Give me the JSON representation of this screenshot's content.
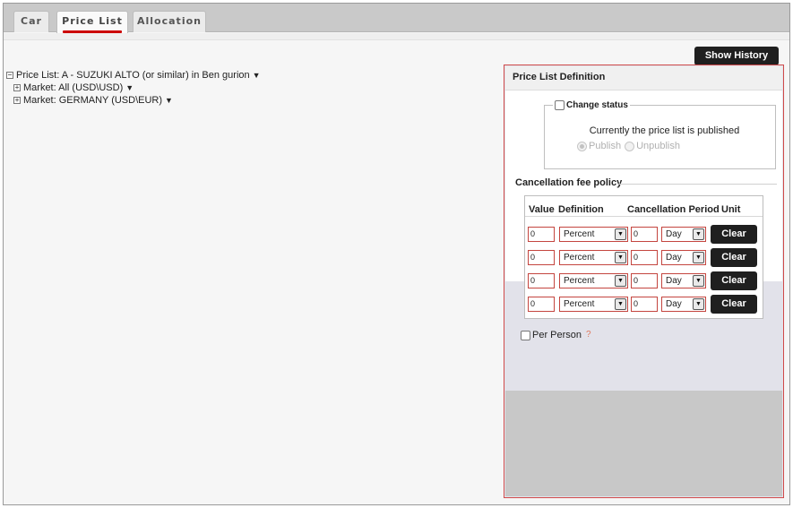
{
  "tabs": [
    {
      "label": "Car",
      "active": false
    },
    {
      "label": "Price List",
      "active": true
    },
    {
      "label": "Allocation",
      "active": false
    }
  ],
  "tree": {
    "root_label": "Price List: A - SUZUKI ALTO (or similar) in Ben gurion",
    "toggle_expanded": "⊟",
    "toggle_collapsed": "⊞",
    "caret": "▼",
    "markets": [
      {
        "label": "Market: All (USD\\USD)"
      },
      {
        "label": "Market: GERMANY (USD\\EUR)"
      }
    ]
  },
  "show_history_label": "Show History",
  "panel": {
    "title": "Price List Definition",
    "change_status_label": "Change status",
    "status_text": "Currently the price list is published",
    "publish_label": "Publish",
    "unpublish_label": "Unpublish",
    "publish_selected": true,
    "cancellation_title": "Cancellation fee policy",
    "headers": {
      "value": "Value",
      "definition": "Definition",
      "period": "Cancellation Period",
      "unit": "Unit"
    },
    "rows": [
      {
        "value": "0",
        "definition": "Percent",
        "period": "0",
        "unit": "Day",
        "clear": "Clear"
      },
      {
        "value": "0",
        "definition": "Percent",
        "period": "0",
        "unit": "Day",
        "clear": "Clear"
      },
      {
        "value": "0",
        "definition": "Percent",
        "period": "0",
        "unit": "Day",
        "clear": "Clear"
      },
      {
        "value": "0",
        "definition": "Percent",
        "period": "0",
        "unit": "Day",
        "clear": "Clear"
      }
    ],
    "per_person_label": "Per Person",
    "help_icon": "?"
  },
  "colors": {
    "accent_red": "#cc0000",
    "button_dark": "#1f1f1f",
    "panel_border": "#d04a4a"
  }
}
